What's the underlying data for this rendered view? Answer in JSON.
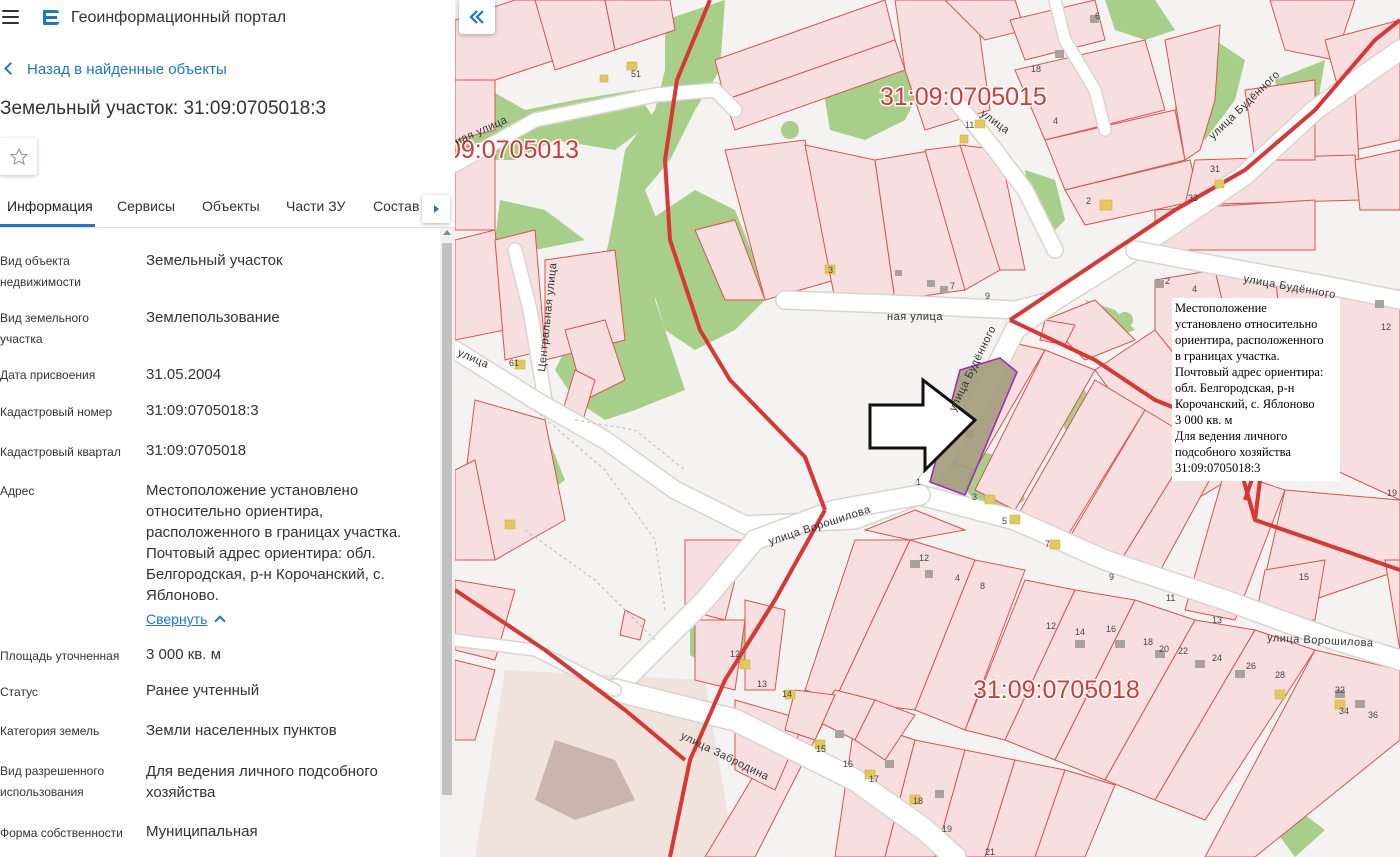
{
  "app": {
    "title": "Геоинформационный портал"
  },
  "nav": {
    "back_label": "Назад в найденные объекты"
  },
  "object": {
    "title": "Земельный участок: 31:09:0705018:3"
  },
  "tabs": [
    {
      "label": "Информация",
      "active": true
    },
    {
      "label": "Сервисы"
    },
    {
      "label": "Объекты"
    },
    {
      "label": "Части ЗУ"
    },
    {
      "label": "Состав"
    }
  ],
  "properties": [
    {
      "label_lines": [
        "Вид объекта",
        "недвижимости"
      ],
      "value_lines": [
        "Земельный участок"
      ]
    },
    {
      "label_lines": [
        "Вид земельного",
        "участка"
      ],
      "value_lines": [
        "Землепользование"
      ]
    },
    {
      "label_lines": [
        "Дата присвоения"
      ],
      "value_lines": [
        "31.05.2004"
      ]
    },
    {
      "label_lines": [
        "Кадастровый номер"
      ],
      "value_lines": [
        "31:09:0705018:3"
      ]
    },
    {
      "label_lines": [
        "Кадастровый квартал"
      ],
      "value_lines": [
        "31:09:0705018"
      ]
    },
    {
      "label_lines": [
        "Адрес"
      ],
      "value_lines": [
        "Местоположение установлено",
        "относительно ориентира,",
        "расположенного в границах участка.",
        "Почтовый адрес ориентира: обл.",
        "Белгородская, р-н Корочанский, с.",
        "Яблоново."
      ]
    },
    {
      "label_lines": [
        "Площадь уточненная"
      ],
      "value_lines": [
        "3 000 кв. м"
      ]
    },
    {
      "label_lines": [
        "Статус"
      ],
      "value_lines": [
        "Ранее учтенный"
      ]
    },
    {
      "label_lines": [
        "Категория земель"
      ],
      "value_lines": [
        "Земли населенных пунктов"
      ]
    },
    {
      "label_lines": [
        "Вид разрешенного",
        "использования"
      ],
      "value_lines": [
        "Для ведения личного подсобного",
        "хозяйства"
      ]
    },
    {
      "label_lines": [
        "Форма собственности"
      ],
      "value_lines": [
        "Муниципальная"
      ]
    }
  ],
  "address_toggle": {
    "label": "Свернуть"
  },
  "map": {
    "quarters": [
      {
        "label": "31:09:0705015"
      },
      {
        "label": "09:0705013"
      },
      {
        "label": "31:09:0705018"
      }
    ],
    "streets": [
      {
        "label": "улица Будённого"
      },
      {
        "label": "улица Будённого"
      },
      {
        "label": "улица Будённого"
      },
      {
        "label": "улица Ворошилова"
      },
      {
        "label": "улица Ворошилова"
      },
      {
        "label": "улица Забродина"
      },
      {
        "label": "Центральная улица"
      },
      {
        "label": "ная улица"
      },
      {
        "label": "ная улица"
      },
      {
        "label": "улица"
      },
      {
        "label": "улица"
      }
    ],
    "house_numbers": [
      "51",
      "6",
      "18",
      "11",
      "4",
      "2",
      "31",
      "33",
      "3",
      "7",
      "9",
      "2",
      "4",
      "6",
      "18",
      "12",
      "61",
      "1",
      "3",
      "5",
      "7",
      "9",
      "11",
      "13",
      "15",
      "12",
      "4",
      "8",
      "12",
      "14",
      "16",
      "18",
      "20",
      "22",
      "24",
      "26",
      "28",
      "12",
      "13",
      "14",
      "15",
      "16",
      "17",
      "18",
      "19",
      "21",
      "32",
      "34",
      "36",
      "19"
    ],
    "colors": {
      "parcel_fill": "#f7dfe0",
      "parcel_stroke": "#d9534f",
      "boundary": "#d93636",
      "green": "#a7cf8a",
      "road": "#ffffff",
      "highlight_stroke": "#9b2fb5"
    }
  },
  "popup": {
    "lines": [
      "Местоположение",
      "установлено относительно",
      "ориентира, расположенного",
      "в границах участка.",
      "Почтовый адрес ориентира:",
      "обл. Белгородская, р-н",
      "Корочанский, с. Яблоново",
      "3 000 кв. м",
      "Для ведения личного",
      "подсобного хозяйства",
      "31:09:0705018:3"
    ]
  },
  "icons": {
    "menu": "hamburger-icon",
    "logo": "portal-logo-icon",
    "back": "chevron-left-icon",
    "favorite": "star-icon",
    "tabs_next": "chevron-right-icon",
    "collapse_panel": "double-chevron-left-icon",
    "address_toggle": "chevron-up-icon"
  }
}
